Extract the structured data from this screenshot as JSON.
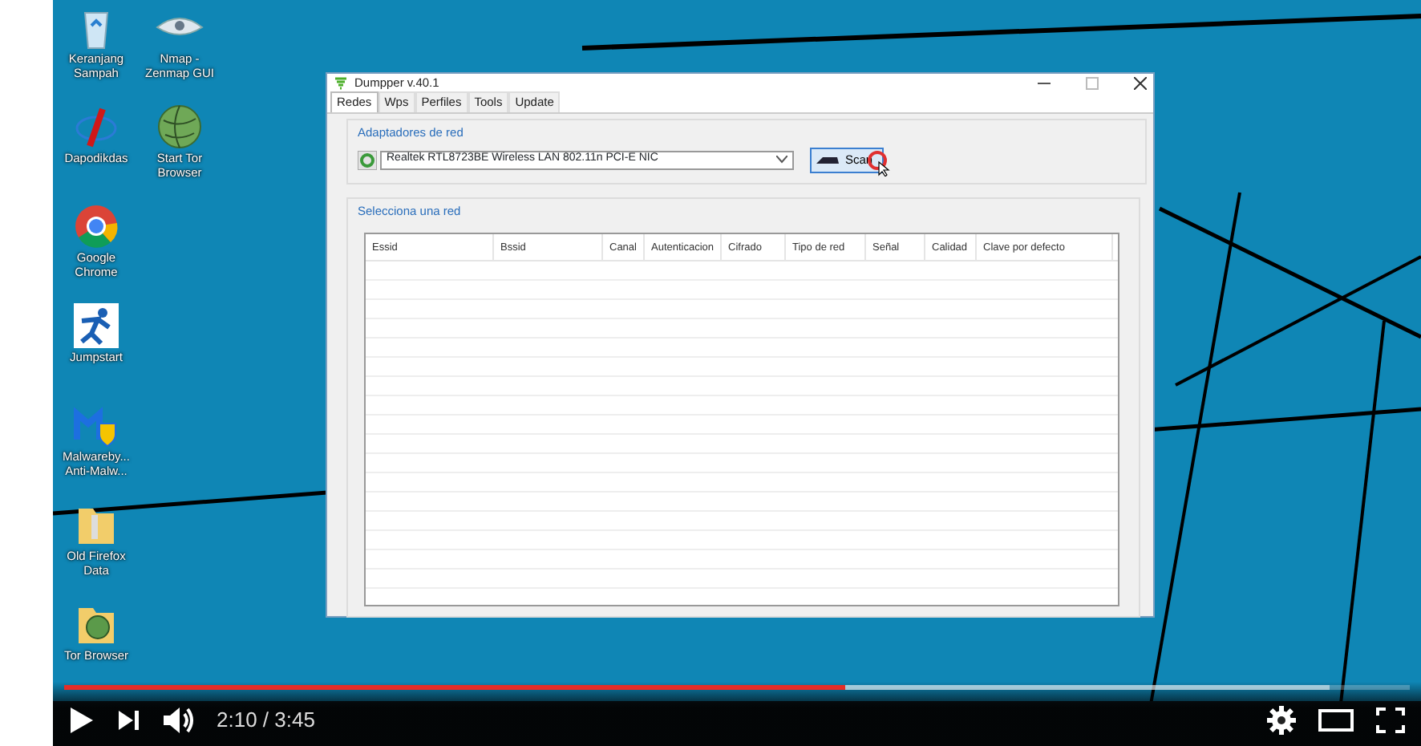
{
  "desktop": {
    "icon_columns": [
      [
        {
          "label": "Keranjang Sampah",
          "kind": "bin"
        },
        {
          "label": "Dapodikdas",
          "kind": "slash"
        },
        {
          "label": "Google Chrome",
          "kind": "chrome"
        },
        {
          "label": "Jumpstart",
          "kind": "runner"
        },
        {
          "label": "Malwareby... Anti-Malw...",
          "kind": "shield"
        },
        {
          "label": "Old Firefox Data",
          "kind": "folder"
        },
        {
          "label": "Tor Browser",
          "kind": "globefolder"
        }
      ],
      [
        {
          "label": "Nmap - Zenmap GUI",
          "kind": "eye"
        },
        {
          "label": "Start Tor Browser",
          "kind": "globe"
        }
      ]
    ]
  },
  "window": {
    "title": "Dumpper v.40.1",
    "tabs": [
      {
        "label": "Redes",
        "selected": true
      },
      {
        "label": "Wps",
        "selected": false
      },
      {
        "label": "Perfiles",
        "selected": false
      },
      {
        "label": "Tools",
        "selected": false
      },
      {
        "label": "Update",
        "selected": false
      }
    ],
    "adapters": {
      "title": "Adaptadores de red",
      "adapter": "Realtek RTL8723BE Wireless LAN 802.11n PCI-E NIC",
      "button": "Scan"
    },
    "networks": {
      "title": "Selecciona una red",
      "columns": [
        "Essid",
        "Bssid",
        "Canal",
        "Autenticacion",
        "Cifrado",
        "Tipo de red",
        "Señal",
        "Calidad",
        "Clave por defecto"
      ]
    }
  },
  "player": {
    "progress": {
      "level": 0.58
    },
    "buffered": {
      "level": 0.94
    },
    "time": "2:10 / 3:45"
  }
}
